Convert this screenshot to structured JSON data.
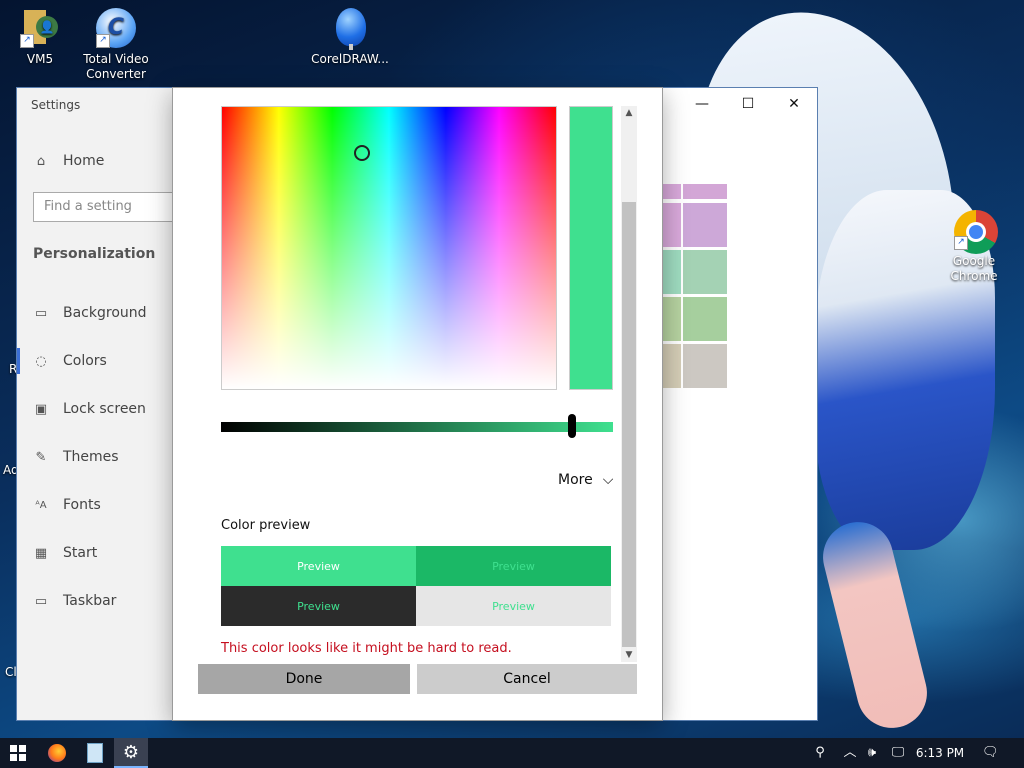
{
  "desktop": {
    "icons": [
      {
        "label": "VM5",
        "glyph": "👤",
        "icon": "vm5-app-icon"
      },
      {
        "label": "Total Video Converter",
        "glyph": "C",
        "icon": "total-video-converter-icon"
      },
      {
        "label": "CorelDRAW...",
        "glyph": "",
        "icon": "coreldraw-icon"
      },
      {
        "label": "Google Chrome",
        "glyph": "",
        "icon": "chrome-icon"
      }
    ],
    "edge_letters": [
      "R",
      "Ad",
      "Cl"
    ]
  },
  "settings": {
    "title": "Settings",
    "home_label": "Home",
    "search_placeholder": "Find a setting",
    "section_title": "Personalization",
    "nav_items": [
      {
        "label": "Background",
        "icon": "picture-icon",
        "glyph": "▭"
      },
      {
        "label": "Colors",
        "icon": "palette-icon",
        "glyph": "◌"
      },
      {
        "label": "Lock screen",
        "icon": "lock-screen-icon",
        "glyph": "▣"
      },
      {
        "label": "Themes",
        "icon": "themes-icon",
        "glyph": "✎"
      },
      {
        "label": "Fonts",
        "icon": "fonts-icon",
        "glyph": "ᴬA"
      },
      {
        "label": "Start",
        "icon": "start-icon",
        "glyph": "▦"
      },
      {
        "label": "Taskbar",
        "icon": "taskbar-icon",
        "glyph": "▭"
      }
    ],
    "window_controls": {
      "minimize": "—",
      "maximize": "☐",
      "close": "✕"
    },
    "swatch_colors": [
      "#d8a8da",
      "#d3a6d6",
      "#d8a8da",
      "#cda8d8",
      "#9fdcc0",
      "#a4d2b4",
      "#b6d2a0",
      "#a6cf9e",
      "#d4cdb6",
      "#ccc8c2"
    ]
  },
  "picker": {
    "selected_color": "#3fe08f",
    "more_label": "More",
    "preview_label": "Color preview",
    "preview_tiles": [
      {
        "text": "Preview",
        "bg": "#3fe08f",
        "fg": "#ffffff"
      },
      {
        "text": "Preview",
        "bg": "#1bb866",
        "fg": "#3fe08f"
      },
      {
        "text": "Preview",
        "bg": "#2b2b2b",
        "fg": "#3fe08f"
      },
      {
        "text": "Preview",
        "bg": "#e6e6e6",
        "fg": "#3fe08f"
      }
    ],
    "warning": "This color looks like it might be hard to read.",
    "done_label": "Done",
    "cancel_label": "Cancel"
  },
  "taskbar": {
    "time": "6:13 PM"
  }
}
